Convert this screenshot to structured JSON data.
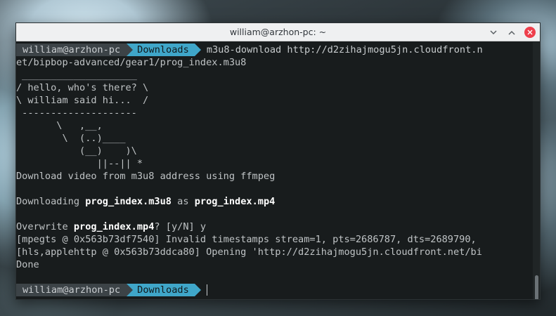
{
  "window": {
    "title": "william@arzhon-pc: ~",
    "controls": {
      "minimize_icon": "chevron-down-icon",
      "maximize_icon": "chevron-up-icon",
      "close_icon": "close-icon"
    }
  },
  "prompt": {
    "user": "william@arzhon-pc",
    "dir": "Downloads"
  },
  "terminal": {
    "command": "m3u8-download http://d2zihajmogu5jn.cloudfront.n",
    "command_wrap": "et/bipbop-advanced/gear1/prog_index.m3u8",
    "cowsay": [
      " ____________________",
      "/ hello, who's there? \\",
      "\\ william said hi...  /",
      " --------------------",
      "       \\   ,__,",
      "        \\  (..)____",
      "           (__)    )\\",
      "              ||--|| *"
    ],
    "info": "Download video from m3u8 address using ffmpeg",
    "downloading": {
      "prefix": "Downloading ",
      "source": "prog_index.m3u8",
      "mid": " as ",
      "target": "prog_index.mp4"
    },
    "overwrite": {
      "prefix": "Overwrite ",
      "file": "prog_index.mp4",
      "suffix": "? [y/N] y"
    },
    "log1": "[mpegts @ 0x563b73df7540] Invalid timestamps stream=1, pts=2686787, dts=2689790,",
    "log2": "[hls,applehttp @ 0x563b73ddca80] Opening 'http://d2zihajmogu5jn.cloudfront.net/bi",
    "done": "Done"
  },
  "colors": {
    "terminal_bg": "#181c1d",
    "prompt_user_bg": "#3c4347",
    "prompt_dir_bg": "#3fa6c9",
    "close_button": "#ee3f4c"
  }
}
